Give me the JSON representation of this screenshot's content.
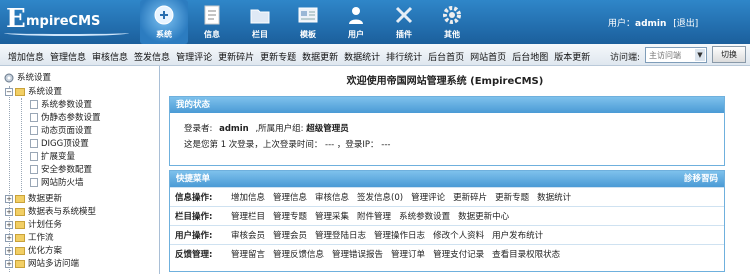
{
  "brand": {
    "logo_big": "E",
    "logo_rest": "mpireCMS"
  },
  "nav": [
    {
      "label": "系统",
      "icon": "system-icon",
      "active": true
    },
    {
      "label": "信息",
      "icon": "document-icon"
    },
    {
      "label": "栏目",
      "icon": "folder-icon"
    },
    {
      "label": "模板",
      "icon": "template-icon"
    },
    {
      "label": "用户",
      "icon": "user-icon"
    },
    {
      "label": "插件",
      "icon": "tools-icon"
    },
    {
      "label": "其他",
      "icon": "gear-icon"
    }
  ],
  "user": {
    "prefix": "用户：",
    "name": "admin",
    "logout": "[退出]"
  },
  "quickbar": [
    "增加信息",
    "管理信息",
    "审核信息",
    "签发信息",
    "管理评论",
    "更新碎片",
    "更新专题",
    "数据更新",
    "数据统计",
    "排行统计",
    "后台首页",
    "网站首页",
    "后台地图",
    "版本更新"
  ],
  "visit": {
    "label": "访问端:",
    "selected": "主访问端",
    "switch": "切换"
  },
  "sidebar": {
    "items": [
      "系统设置",
      "系统设置",
      "系统参数设置",
      "伪静态参数设置",
      "动态页面设置",
      "DIGG顶设置",
      "扩展变量",
      "安全参数配置",
      "网站防火墙",
      "数据更新",
      "数据表与系统模型",
      "计划任务",
      "工作流",
      "优化方案",
      "网站多访问端"
    ]
  },
  "main": {
    "welcome": "欢迎使用帝国网站管理系统 (EmpireCMS)",
    "status_title": "我的状态",
    "login_label": "登录者:",
    "login_user": "admin",
    "group_label": ",所属用户组:",
    "group_name": "超级管理员",
    "login_info": "这是您第 1 次登录，上次登录时间：  ---  ，登录IP：  ---",
    "quick_title": "快捷菜单",
    "quick_right": "診移習码",
    "ops": [
      {
        "head": "信息操作:",
        "links": [
          "增加信息",
          "管理信息",
          "审核信息",
          "签发信息(0)",
          "管理评论",
          "更新碎片",
          "更新专题",
          "数据统计"
        ]
      },
      {
        "head": "栏目操作:",
        "links": [
          "管理栏目",
          "管理专题",
          "管理采集",
          "附件管理",
          "系统参数设置",
          "数据更新中心"
        ]
      },
      {
        "head": "用户操作:",
        "links": [
          "审核会员",
          "管理会员",
          "管理登陆日志",
          "管理操作日志",
          "修改个人资料",
          "用户发布统计"
        ]
      },
      {
        "head": "反馈管理:",
        "links": [
          "管理留言",
          "管理反馈信息",
          "管理错误报告",
          "管理订单",
          "管理支付记录",
          "查看目录权限状态"
        ]
      }
    ]
  },
  "colors": {
    "header": "#1b5f9c",
    "panel": "#4a9ad5"
  }
}
